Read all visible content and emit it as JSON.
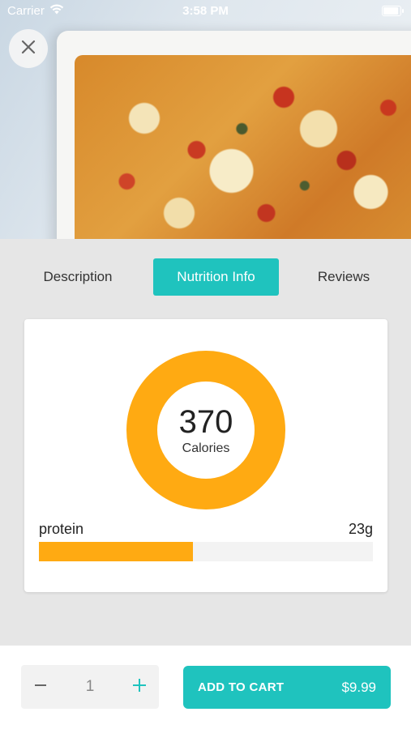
{
  "status_bar": {
    "carrier": "Carrier",
    "time": "3:58 PM"
  },
  "tabs": [
    {
      "label": "Description",
      "active": false
    },
    {
      "label": "Nutrition Info",
      "active": true
    },
    {
      "label": "Reviews",
      "active": false
    }
  ],
  "nutrition": {
    "calories_value": "370",
    "calories_label": "Calories",
    "nutrients": [
      {
        "name": "protein",
        "amount": "23g",
        "fill_fraction": 0.46
      }
    ]
  },
  "cart": {
    "quantity": "1",
    "add_label": "ADD TO CART",
    "price": "$9.99"
  },
  "colors": {
    "accent": "#1fc3be",
    "chart": "#ffaa12",
    "background": "#e6e6e6"
  },
  "icons": [
    "wifi-icon",
    "battery-icon",
    "close-icon",
    "minus-icon",
    "plus-icon"
  ]
}
